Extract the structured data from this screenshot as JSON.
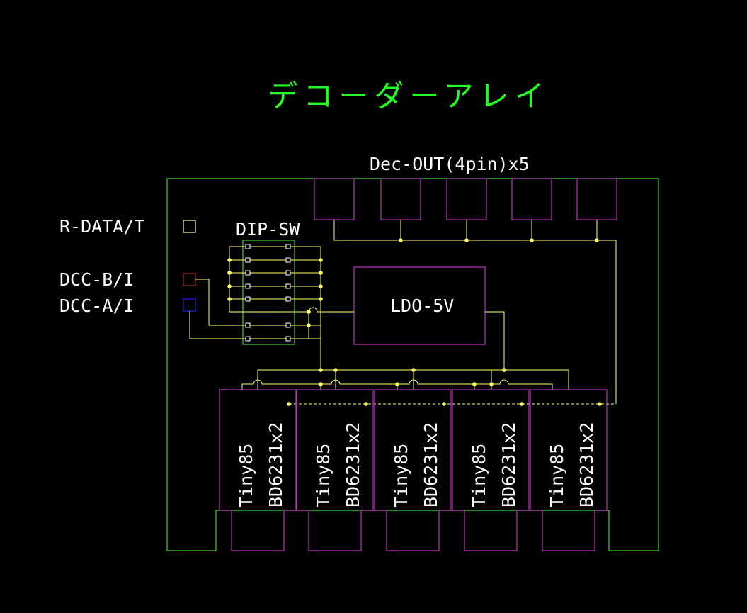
{
  "title": "デコーダーアレイ",
  "labels": {
    "dec_out": "Dec-OUT(4pin)x5",
    "r_data": "R-DATA/T",
    "dcc_b": "DCC-B/I",
    "dcc_a": "DCC-A/I",
    "dip_sw": "DIP-SW",
    "ldo": "LDO-5V"
  },
  "modules": [
    {
      "chip": "Tiny85",
      "driver": "BD6231x2"
    },
    {
      "chip": "Tiny85",
      "driver": "BD6231x2"
    },
    {
      "chip": "Tiny85",
      "driver": "BD6231x2"
    },
    {
      "chip": "Tiny85",
      "driver": "BD6231x2"
    },
    {
      "chip": "Tiny85",
      "driver": "BD6231x2"
    }
  ],
  "colors": {
    "background": "#000000",
    "title": "#22ff22",
    "board_outline": "#33dd33",
    "component": "#bb33bb",
    "wire": "#ffff66",
    "text": "#ffffff",
    "r_data_pad": "#ffffaa",
    "dcc_b_pad": "#aa2222",
    "dcc_a_pad": "#2222ee",
    "dip_frame": "#44cc44"
  }
}
